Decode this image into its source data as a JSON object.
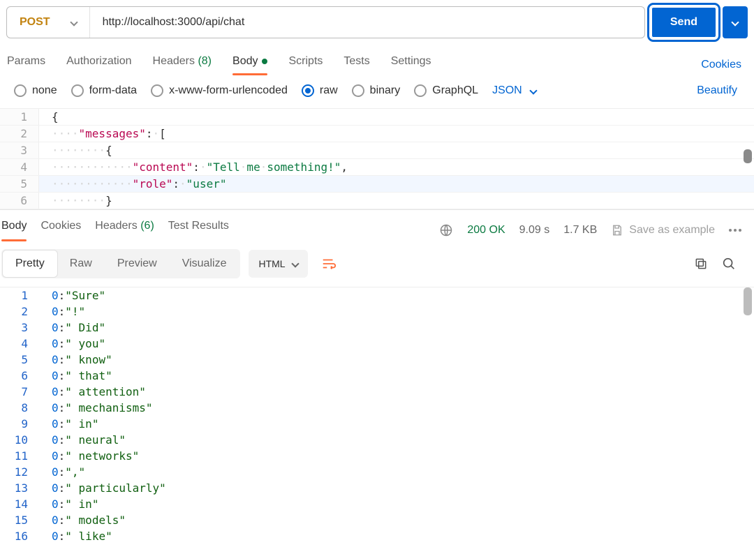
{
  "request": {
    "method": "POST",
    "url": "http://localhost:3000/api/chat",
    "send_label": "Send"
  },
  "tabs": {
    "params": "Params",
    "authorization": "Authorization",
    "headers": "Headers",
    "headers_count": "(8)",
    "body": "Body",
    "scripts": "Scripts",
    "tests": "Tests",
    "settings": "Settings",
    "cookies_link": "Cookies"
  },
  "body_types": {
    "none": "none",
    "form_data": "form-data",
    "x_www": "x-www-form-urlencoded",
    "raw": "raw",
    "binary": "binary",
    "graphql": "GraphQL",
    "format": "JSON",
    "beautify": "Beautify"
  },
  "request_body_lines": [
    {
      "n": 1,
      "indent": 0,
      "segs": [
        {
          "t": "{",
          "c": "tok-punc"
        }
      ]
    },
    {
      "n": 2,
      "indent": 1,
      "segs": [
        {
          "t": "\"messages\"",
          "c": "tok-key"
        },
        {
          "t": ":",
          "c": "tok-punc"
        },
        {
          "t": " ",
          "c": "ws-dots",
          "dots": 1
        },
        {
          "t": "[",
          "c": "tok-punc"
        }
      ]
    },
    {
      "n": 3,
      "indent": 2,
      "segs": [
        {
          "t": "{",
          "c": "tok-punc"
        }
      ]
    },
    {
      "n": 4,
      "indent": 3,
      "segs": [
        {
          "t": "\"content\"",
          "c": "tok-key"
        },
        {
          "t": ":",
          "c": "tok-punc"
        },
        {
          "t": " ",
          "c": "ws-dots",
          "dots": 1
        },
        {
          "t": "\"Tell me something!\"",
          "c": "tok-str",
          "sp": true
        },
        {
          "t": ",",
          "c": "tok-punc"
        }
      ]
    },
    {
      "n": 5,
      "indent": 3,
      "active": true,
      "segs": [
        {
          "t": "\"role\"",
          "c": "tok-key"
        },
        {
          "t": ":",
          "c": "tok-punc"
        },
        {
          "t": " ",
          "c": "ws-dots",
          "dots": 1
        },
        {
          "t": "\"user\"",
          "c": "tok-str"
        }
      ]
    },
    {
      "n": 6,
      "indent": 2,
      "segs": [
        {
          "t": "}",
          "c": "tok-punc"
        }
      ]
    }
  ],
  "response": {
    "tabs": {
      "body": "Body",
      "cookies": "Cookies",
      "headers": "Headers",
      "headers_count": "(6)",
      "test_results": "Test Results"
    },
    "status": "200 OK",
    "time": "9.09 s",
    "size": "1.7 KB",
    "save_example": "Save as example",
    "view_tabs": {
      "pretty": "Pretty",
      "raw": "Raw",
      "preview": "Preview",
      "visualize": "Visualize",
      "format": "HTML"
    },
    "lines": [
      {
        "n": 1,
        "prefix": "0",
        "val": "\"Sure\""
      },
      {
        "n": 2,
        "prefix": "0",
        "val": "\"!\""
      },
      {
        "n": 3,
        "prefix": "0",
        "val": "\" Did\""
      },
      {
        "n": 4,
        "prefix": "0",
        "val": "\" you\""
      },
      {
        "n": 5,
        "prefix": "0",
        "val": "\" know\""
      },
      {
        "n": 6,
        "prefix": "0",
        "val": "\" that\""
      },
      {
        "n": 7,
        "prefix": "0",
        "val": "\" attention\""
      },
      {
        "n": 8,
        "prefix": "0",
        "val": "\" mechanisms\""
      },
      {
        "n": 9,
        "prefix": "0",
        "val": "\" in\""
      },
      {
        "n": 10,
        "prefix": "0",
        "val": "\" neural\""
      },
      {
        "n": 11,
        "prefix": "0",
        "val": "\" networks\""
      },
      {
        "n": 12,
        "prefix": "0",
        "val": "\",\""
      },
      {
        "n": 13,
        "prefix": "0",
        "val": "\" particularly\""
      },
      {
        "n": 14,
        "prefix": "0",
        "val": "\" in\""
      },
      {
        "n": 15,
        "prefix": "0",
        "val": "\" models\""
      },
      {
        "n": 16,
        "prefix": "0",
        "val": "\" like\""
      }
    ]
  }
}
